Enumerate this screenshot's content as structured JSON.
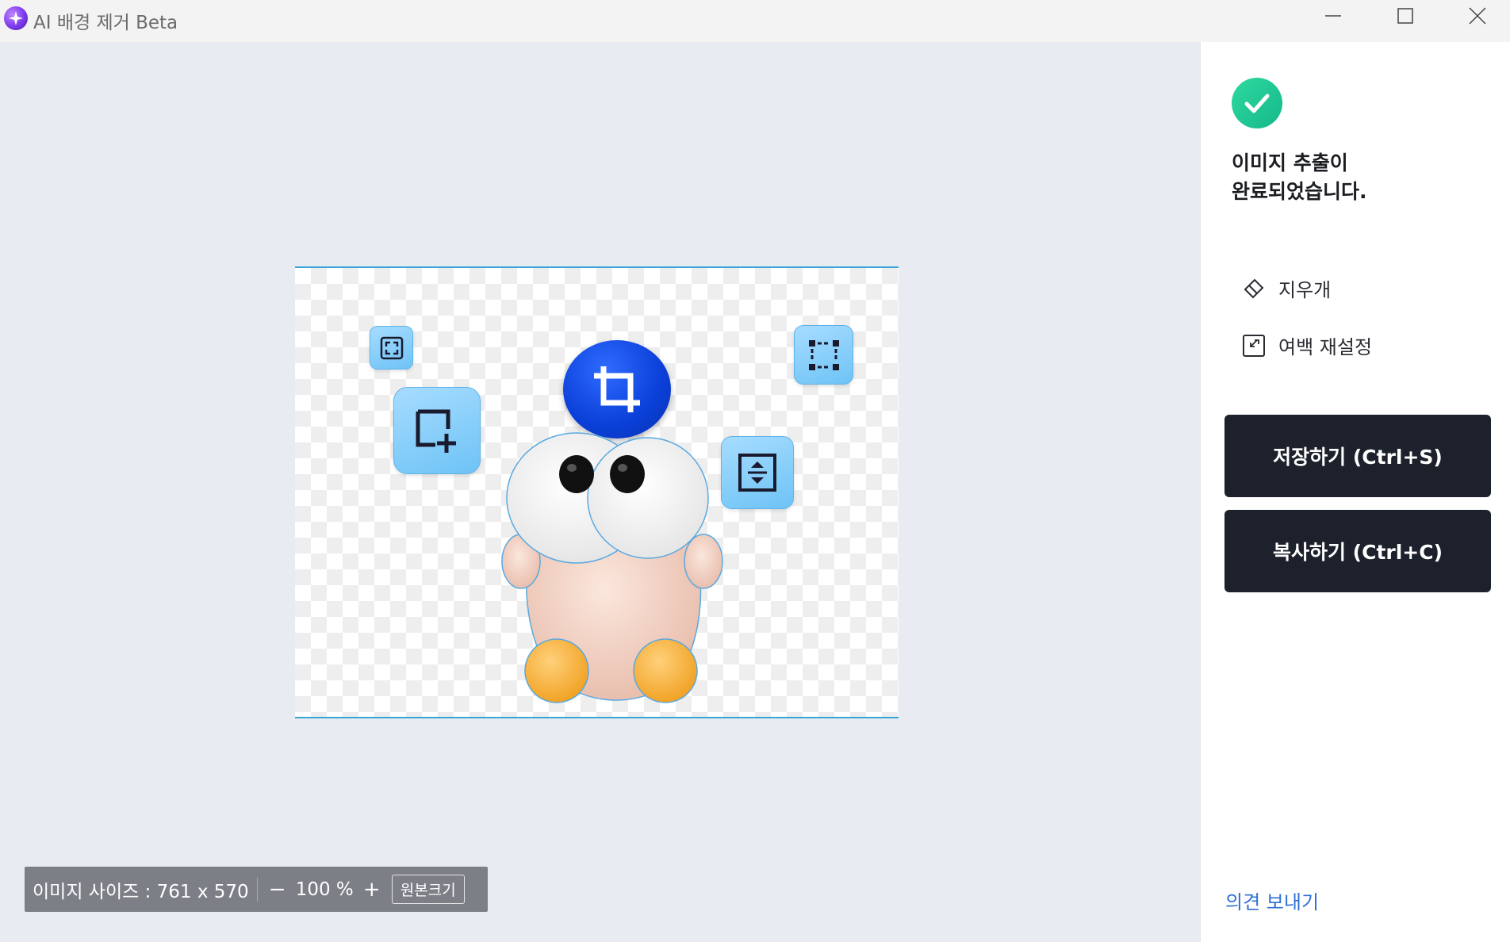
{
  "window": {
    "title": "AI 배경 제거 Beta",
    "icon": "sparkle-app-icon",
    "controls": [
      "minimize-icon",
      "maximize-icon",
      "close-icon"
    ]
  },
  "statusbar": {
    "size_label": "이미지 사이즈 : 761 x 570",
    "zoom_out": "−",
    "zoom_value": "100 %",
    "zoom_in": "+",
    "original_size": "원본크기"
  },
  "panel": {
    "done_icon": "checkmark-icon",
    "done_line1": "이미지 추출이",
    "done_line2": "완료되었습니다.",
    "tools": [
      {
        "label": "지우개",
        "icon": "eraser-icon"
      },
      {
        "label": "여백 재설정",
        "icon": "resize-margin-icon"
      }
    ],
    "save_button": "저장하기 (Ctrl+S)",
    "copy_button": "복사하기 (Ctrl+C)",
    "feedback": "의견 보내기"
  },
  "colors": {
    "accent_green": "#1fc796",
    "button_dark": "#1c212b",
    "link_blue": "#2f6fd6",
    "frame_border": "#3aa3d8"
  }
}
